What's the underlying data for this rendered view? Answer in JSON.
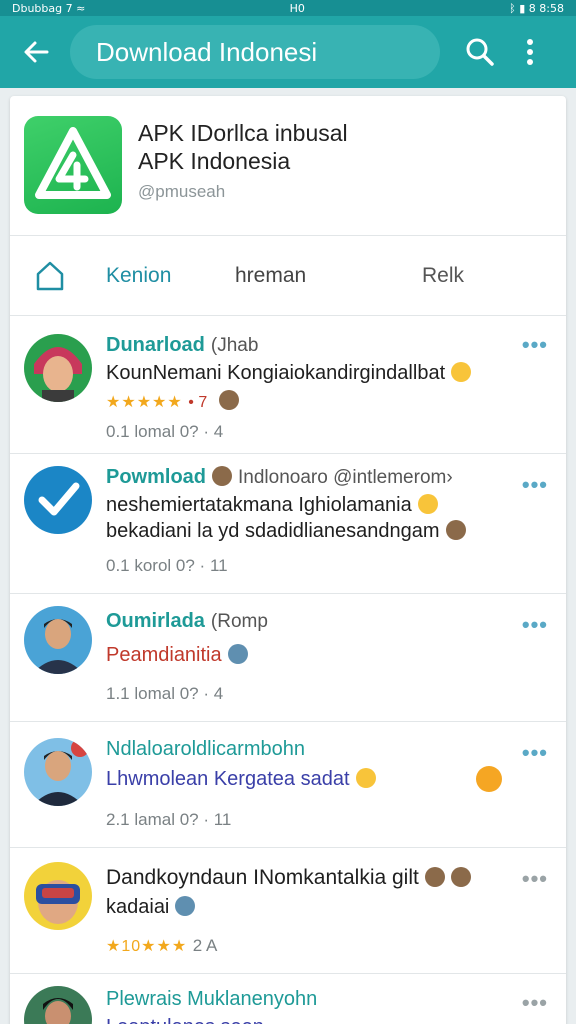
{
  "status_bar": {
    "left": "Dbubbag 7 ≈",
    "center": "H0",
    "right": "ᛒ ▮ 8 8:58"
  },
  "toolbar": {
    "back_icon": "arrow-left-icon",
    "search_text": "Download Indonesi",
    "search_icon": "magnifier-icon",
    "more_icon": "more-vertical-icon"
  },
  "app": {
    "title_line1": "APK IDorllca inbusal",
    "title_line2": "APK Indonesia",
    "handle": "@pmuseah"
  },
  "tabs": [
    {
      "label": "Kenion"
    },
    {
      "label": "hreman"
    },
    {
      "label": "Relk"
    }
  ],
  "posts": [
    {
      "name": "Dunarload",
      "sub": "(Jhab",
      "text": "KounNemani Kongiaiokandirgindallbat",
      "rating_stars": "★★★★★",
      "rating_extra": "• 7",
      "meta": "0.1 lomal 0? · 4"
    },
    {
      "name": "Powmload",
      "sub": "Indlonoaro  @intlemerom›",
      "text_line1": "neshemiertatakmana Ighiolamania",
      "text_line2": "bekadiani la yd sdadidlianesandngam",
      "meta": "0.1 korol 0? · 11"
    },
    {
      "name": "Oumirlada",
      "sub": "(Romp",
      "text": "Peamdianitia",
      "meta": "1.1 lomal 0? · 4"
    },
    {
      "name": "Ndlaloaroldlicarmbohn",
      "text": "Lhwmolean Kergatea sadat",
      "meta": "2.1 lamal 0? · 11"
    },
    {
      "text_line1": "Dandkoyndaun INomkantalkia gilt",
      "text_line2": "kadaiai",
      "rating_stars": "★10★★★",
      "rating_extra": "2 A"
    },
    {
      "name": "Plewrais Muklanenyohn",
      "text": "Leaptulanes seen"
    }
  ],
  "colors": {
    "toolbar": "#21a6a7",
    "accent": "#1e9a97",
    "more_dots": "#5aa9c6"
  }
}
